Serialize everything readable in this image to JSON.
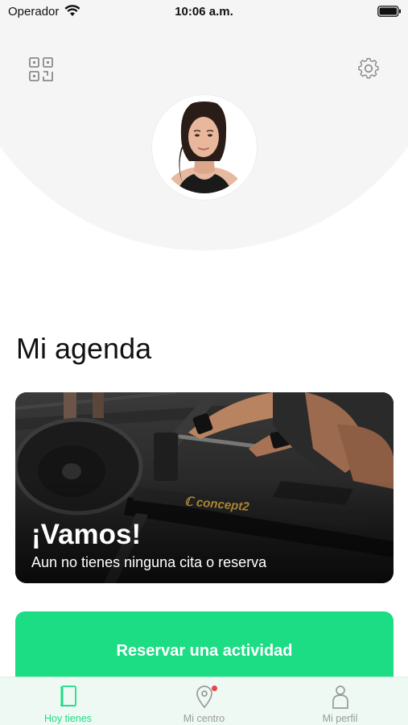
{
  "status_bar": {
    "carrier": "Operador",
    "time": "10:06 a.m."
  },
  "header": {
    "qr_icon": "qr-code-icon",
    "settings_icon": "gear-icon"
  },
  "agenda": {
    "title": "Mi agenda",
    "card": {
      "title": "¡Vamos!",
      "subtitle": "Aun no tienes ninguna cita o reserva",
      "brand_text": "concept2"
    },
    "cta_label": "Reservar una actividad"
  },
  "tabs": [
    {
      "label": "Hoy tienes",
      "icon": "book-icon",
      "active": true
    },
    {
      "label": "Mi centro",
      "icon": "location-pin-icon",
      "active": false,
      "notification_dot": true
    },
    {
      "label": "Mi perfil",
      "icon": "person-icon",
      "active": false
    }
  ],
  "colors": {
    "accent": "#1cdc84",
    "hero_background": "#f5f5f5",
    "tab_bar_background": "#eef9f4",
    "notification": "#e84545"
  }
}
